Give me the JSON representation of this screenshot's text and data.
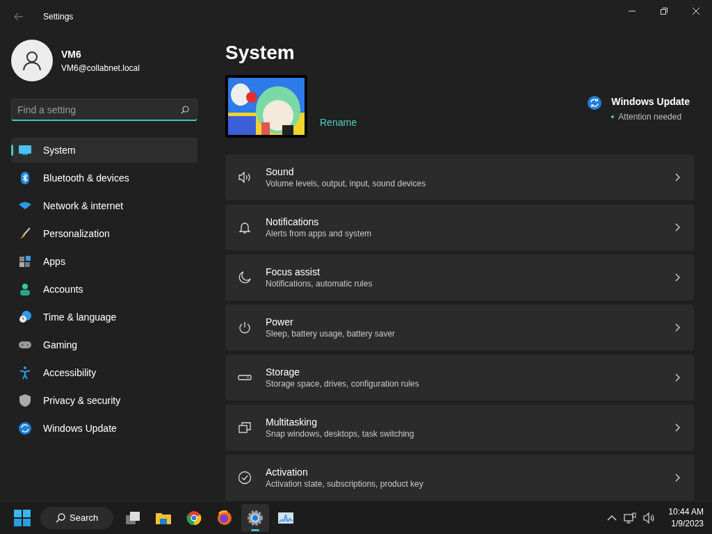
{
  "window": {
    "title": "Settings"
  },
  "user": {
    "name": "VM6",
    "email": "VM6@collabnet.local"
  },
  "search": {
    "placeholder": "Find a setting"
  },
  "nav": [
    {
      "label": "System",
      "selected": true
    },
    {
      "label": "Bluetooth & devices",
      "selected": false
    },
    {
      "label": "Network & internet",
      "selected": false
    },
    {
      "label": "Personalization",
      "selected": false
    },
    {
      "label": "Apps",
      "selected": false
    },
    {
      "label": "Accounts",
      "selected": false
    },
    {
      "label": "Time & language",
      "selected": false
    },
    {
      "label": "Gaming",
      "selected": false
    },
    {
      "label": "Accessibility",
      "selected": false
    },
    {
      "label": "Privacy & security",
      "selected": false
    },
    {
      "label": "Windows Update",
      "selected": false
    }
  ],
  "page": {
    "title": "System",
    "device": {
      "rename": "Rename"
    },
    "update": {
      "title": "Windows Update",
      "status": "Attention needed"
    },
    "cards": [
      {
        "title": "Sound",
        "subtitle": "Volume levels, output, input, sound devices"
      },
      {
        "title": "Notifications",
        "subtitle": "Alerts from apps and system"
      },
      {
        "title": "Focus assist",
        "subtitle": "Notifications, automatic rules"
      },
      {
        "title": "Power",
        "subtitle": "Sleep, battery usage, battery saver"
      },
      {
        "title": "Storage",
        "subtitle": "Storage space, drives, configuration rules"
      },
      {
        "title": "Multitasking",
        "subtitle": "Snap windows, desktops, task switching"
      },
      {
        "title": "Activation",
        "subtitle": "Activation state, subscriptions, product key"
      }
    ]
  },
  "taskbar": {
    "search": "Search",
    "apps": [
      {
        "selected": false
      },
      {
        "selected": false
      },
      {
        "selected": false
      },
      {
        "selected": false
      },
      {
        "selected": true
      },
      {
        "selected": false
      }
    ],
    "time": "10:44 AM",
    "date": "1/9/2023"
  }
}
